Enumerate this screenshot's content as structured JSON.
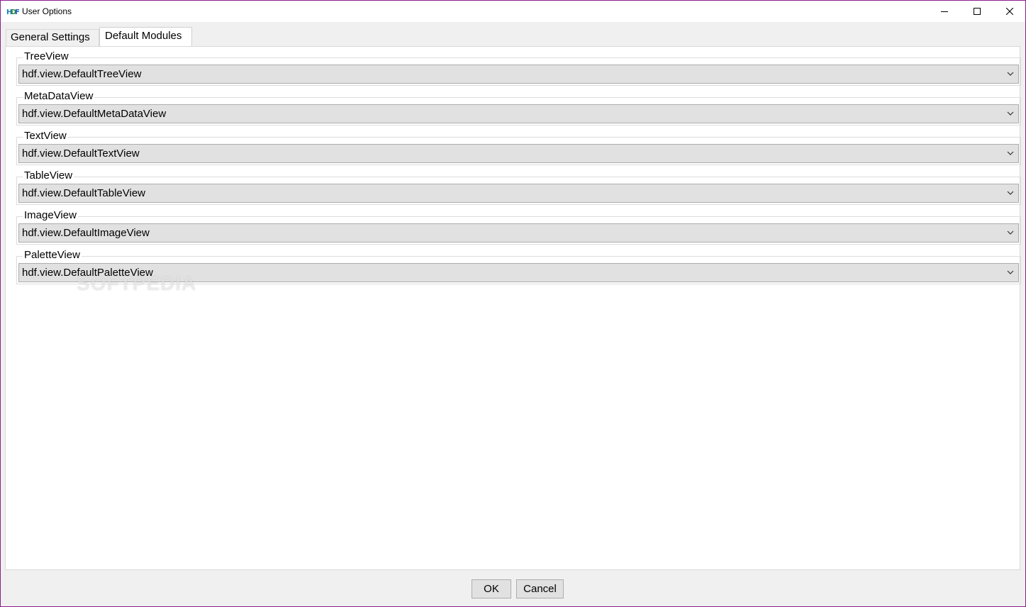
{
  "window": {
    "title": "User Options",
    "app_icon": "hdf-logo-icon",
    "controls": [
      "minimize-icon",
      "maximize-icon",
      "close-icon"
    ]
  },
  "tabs": [
    {
      "label": "General Settings",
      "selected": false
    },
    {
      "label": "Default Modules",
      "selected": true
    }
  ],
  "modules": [
    {
      "label": "TreeView",
      "value": "hdf.view.DefaultTreeView"
    },
    {
      "label": "MetaDataView",
      "value": "hdf.view.DefaultMetaDataView"
    },
    {
      "label": "TextView",
      "value": "hdf.view.DefaultTextView"
    },
    {
      "label": "TableView",
      "value": "hdf.view.DefaultTableView"
    },
    {
      "label": "ImageView",
      "value": "hdf.view.DefaultImageView"
    },
    {
      "label": "PaletteView",
      "value": "hdf.view.DefaultPaletteView"
    }
  ],
  "watermark": "SOFTPEDIA",
  "buttons": {
    "ok": "OK",
    "cancel": "Cancel"
  },
  "colors": {
    "window_border": "#8c1e8c",
    "combo_bg": "#e1e1e1",
    "panel_bg": "#ffffff"
  }
}
